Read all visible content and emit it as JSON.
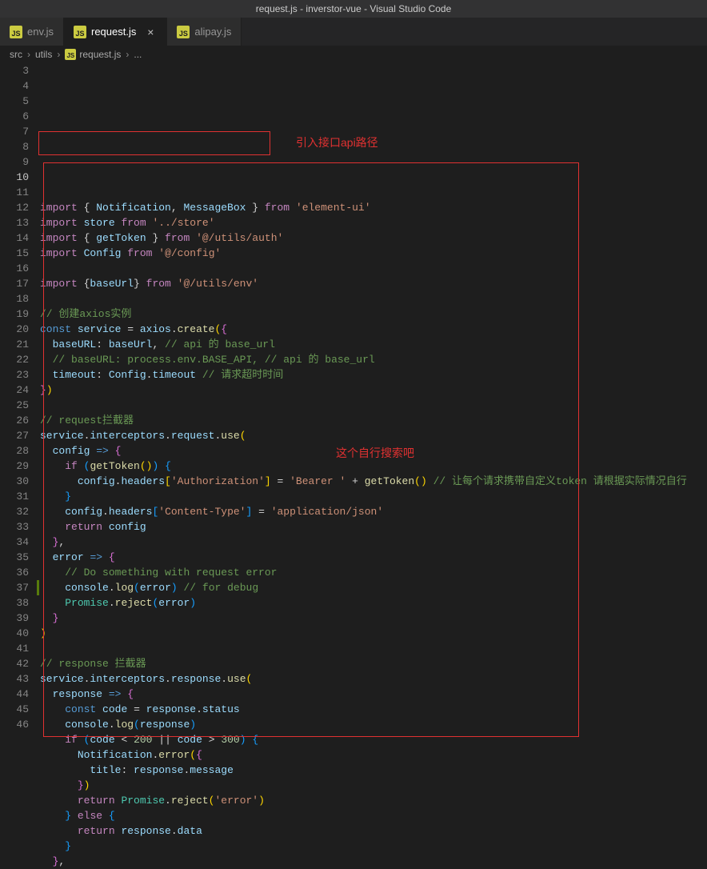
{
  "window_title": "request.js - inverstor-vue - Visual Studio Code",
  "tabs": [
    {
      "icon": "JS",
      "label": "env.js",
      "active": false
    },
    {
      "icon": "JS",
      "label": "request.js",
      "active": true
    },
    {
      "icon": "JS",
      "label": "alipay.js",
      "active": false
    }
  ],
  "breadcrumbs": {
    "parts": [
      "src",
      "utils",
      "request.js",
      "..."
    ],
    "file_icon": "JS"
  },
  "line_start": 3,
  "line_end": 46,
  "current_line": 10,
  "annotations": {
    "box1_label": "引入接口api路径",
    "box2_label": "这个自行搜索吧"
  },
  "code_lines": [
    {
      "n": 3,
      "tokens": [
        [
          "kw2",
          "import"
        ],
        [
          "pun",
          " { "
        ],
        [
          "var",
          "Notification"
        ],
        [
          "pun",
          ", "
        ],
        [
          "var",
          "MessageBox"
        ],
        [
          "pun",
          " } "
        ],
        [
          "kw2",
          "from"
        ],
        [
          "pun",
          " "
        ],
        [
          "str",
          "'element-ui'"
        ]
      ]
    },
    {
      "n": 4,
      "tokens": [
        [
          "kw2",
          "import"
        ],
        [
          "pun",
          " "
        ],
        [
          "var",
          "store"
        ],
        [
          "pun",
          " "
        ],
        [
          "kw2",
          "from"
        ],
        [
          "pun",
          " "
        ],
        [
          "str",
          "'../store'"
        ]
      ]
    },
    {
      "n": 5,
      "tokens": [
        [
          "kw2",
          "import"
        ],
        [
          "pun",
          " { "
        ],
        [
          "var",
          "getToken"
        ],
        [
          "pun",
          " } "
        ],
        [
          "kw2",
          "from"
        ],
        [
          "pun",
          " "
        ],
        [
          "str",
          "'@/utils/auth'"
        ]
      ]
    },
    {
      "n": 6,
      "tokens": [
        [
          "kw2",
          "import"
        ],
        [
          "pun",
          " "
        ],
        [
          "var",
          "Config"
        ],
        [
          "pun",
          " "
        ],
        [
          "kw2",
          "from"
        ],
        [
          "pun",
          " "
        ],
        [
          "str",
          "'@/config'"
        ]
      ]
    },
    {
      "n": 7,
      "tokens": []
    },
    {
      "n": 8,
      "tokens": [
        [
          "kw2",
          "import"
        ],
        [
          "pun",
          " {"
        ],
        [
          "var",
          "baseUrl"
        ],
        [
          "pun",
          "} "
        ],
        [
          "kw2",
          "from"
        ],
        [
          "pun",
          " "
        ],
        [
          "str",
          "'@/utils/env'"
        ]
      ]
    },
    {
      "n": 9,
      "tokens": []
    },
    {
      "n": 10,
      "tokens": [
        [
          "cmt",
          "// 创建axios实例"
        ]
      ]
    },
    {
      "n": 11,
      "tokens": [
        [
          "kw",
          "const"
        ],
        [
          "pun",
          " "
        ],
        [
          "var",
          "service"
        ],
        [
          "pun",
          " = "
        ],
        [
          "var",
          "axios"
        ],
        [
          "pun",
          "."
        ],
        [
          "fn",
          "create"
        ],
        [
          "yel",
          "("
        ],
        [
          "purp",
          "{"
        ]
      ]
    },
    {
      "n": 12,
      "tokens": [
        [
          "pun",
          "  "
        ],
        [
          "var",
          "baseURL"
        ],
        [
          "pun",
          ": "
        ],
        [
          "var",
          "baseUrl"
        ],
        [
          "pun",
          ", "
        ],
        [
          "cmt",
          "// api 的 base_url"
        ]
      ]
    },
    {
      "n": 13,
      "tokens": [
        [
          "pun",
          "  "
        ],
        [
          "cmt",
          "// baseURL: process.env.BASE_API, // api 的 base_url"
        ]
      ]
    },
    {
      "n": 14,
      "tokens": [
        [
          "pun",
          "  "
        ],
        [
          "var",
          "timeout"
        ],
        [
          "pun",
          ": "
        ],
        [
          "var",
          "Config"
        ],
        [
          "pun",
          "."
        ],
        [
          "var",
          "timeout"
        ],
        [
          "pun",
          " "
        ],
        [
          "cmt",
          "// 请求超时时间"
        ]
      ]
    },
    {
      "n": 15,
      "tokens": [
        [
          "purp",
          "}"
        ],
        [
          "yel",
          ")"
        ]
      ]
    },
    {
      "n": 16,
      "tokens": []
    },
    {
      "n": 17,
      "tokens": [
        [
          "cmt",
          "// request拦截器"
        ]
      ]
    },
    {
      "n": 18,
      "tokens": [
        [
          "var",
          "service"
        ],
        [
          "pun",
          "."
        ],
        [
          "var",
          "interceptors"
        ],
        [
          "pun",
          "."
        ],
        [
          "var",
          "request"
        ],
        [
          "pun",
          "."
        ],
        [
          "fn",
          "use"
        ],
        [
          "yel",
          "("
        ]
      ]
    },
    {
      "n": 19,
      "tokens": [
        [
          "pun",
          "  "
        ],
        [
          "var",
          "config"
        ],
        [
          "pun",
          " "
        ],
        [
          "kw",
          "=>"
        ],
        [
          "pun",
          " "
        ],
        [
          "purp",
          "{"
        ]
      ]
    },
    {
      "n": 20,
      "tokens": [
        [
          "pun",
          "    "
        ],
        [
          "kw2",
          "if"
        ],
        [
          "pun",
          " "
        ],
        [
          "blu",
          "("
        ],
        [
          "fn",
          "getToken"
        ],
        [
          "yel",
          "()"
        ],
        [
          "blu",
          ")"
        ],
        [
          "pun",
          " "
        ],
        [
          "blu",
          "{"
        ]
      ]
    },
    {
      "n": 21,
      "tokens": [
        [
          "pun",
          "      "
        ],
        [
          "var",
          "config"
        ],
        [
          "pun",
          "."
        ],
        [
          "var",
          "headers"
        ],
        [
          "yel",
          "["
        ],
        [
          "str",
          "'Authorization'"
        ],
        [
          "yel",
          "]"
        ],
        [
          "pun",
          " = "
        ],
        [
          "str",
          "'Bearer '"
        ],
        [
          "pun",
          " + "
        ],
        [
          "fn",
          "getToken"
        ],
        [
          "yel",
          "()"
        ],
        [
          "pun",
          " "
        ],
        [
          "cmt",
          "// 让每个请求携带自定义token 请根据实际情况自行"
        ]
      ]
    },
    {
      "n": 22,
      "tokens": [
        [
          "pun",
          "    "
        ],
        [
          "blu",
          "}"
        ]
      ]
    },
    {
      "n": 23,
      "tokens": [
        [
          "pun",
          "    "
        ],
        [
          "var",
          "config"
        ],
        [
          "pun",
          "."
        ],
        [
          "var",
          "headers"
        ],
        [
          "blu",
          "["
        ],
        [
          "str",
          "'Content-Type'"
        ],
        [
          "blu",
          "]"
        ],
        [
          "pun",
          " = "
        ],
        [
          "str",
          "'application/json'"
        ]
      ]
    },
    {
      "n": 24,
      "tokens": [
        [
          "pun",
          "    "
        ],
        [
          "kw2",
          "return"
        ],
        [
          "pun",
          " "
        ],
        [
          "var",
          "config"
        ]
      ]
    },
    {
      "n": 25,
      "tokens": [
        [
          "pun",
          "  "
        ],
        [
          "purp",
          "}"
        ],
        [
          "pun",
          ","
        ]
      ]
    },
    {
      "n": 26,
      "tokens": [
        [
          "pun",
          "  "
        ],
        [
          "var",
          "error"
        ],
        [
          "pun",
          " "
        ],
        [
          "kw",
          "=>"
        ],
        [
          "pun",
          " "
        ],
        [
          "purp",
          "{"
        ]
      ]
    },
    {
      "n": 27,
      "tokens": [
        [
          "pun",
          "    "
        ],
        [
          "cmt",
          "// Do something with request error"
        ]
      ]
    },
    {
      "n": 28,
      "tokens": [
        [
          "pun",
          "    "
        ],
        [
          "var",
          "console"
        ],
        [
          "pun",
          "."
        ],
        [
          "fn",
          "log"
        ],
        [
          "blu",
          "("
        ],
        [
          "var",
          "error"
        ],
        [
          "blu",
          ")"
        ],
        [
          "pun",
          " "
        ],
        [
          "cmt",
          "// for debug"
        ]
      ]
    },
    {
      "n": 29,
      "tokens": [
        [
          "pun",
          "    "
        ],
        [
          "cls",
          "Promise"
        ],
        [
          "pun",
          "."
        ],
        [
          "fn",
          "reject"
        ],
        [
          "blu",
          "("
        ],
        [
          "var",
          "error"
        ],
        [
          "blu",
          ")"
        ]
      ]
    },
    {
      "n": 30,
      "tokens": [
        [
          "pun",
          "  "
        ],
        [
          "purp",
          "}"
        ]
      ]
    },
    {
      "n": 31,
      "tokens": [
        [
          "yel",
          ")"
        ]
      ]
    },
    {
      "n": 32,
      "tokens": []
    },
    {
      "n": 33,
      "tokens": [
        [
          "cmt",
          "// response 拦截器"
        ]
      ]
    },
    {
      "n": 34,
      "tokens": [
        [
          "var",
          "service"
        ],
        [
          "pun",
          "."
        ],
        [
          "var",
          "interceptors"
        ],
        [
          "pun",
          "."
        ],
        [
          "var",
          "response"
        ],
        [
          "pun",
          "."
        ],
        [
          "fn",
          "use"
        ],
        [
          "yel",
          "("
        ]
      ]
    },
    {
      "n": 35,
      "tokens": [
        [
          "pun",
          "  "
        ],
        [
          "var",
          "response"
        ],
        [
          "pun",
          " "
        ],
        [
          "kw",
          "=>"
        ],
        [
          "pun",
          " "
        ],
        [
          "purp",
          "{"
        ]
      ]
    },
    {
      "n": 36,
      "tokens": [
        [
          "pun",
          "    "
        ],
        [
          "kw",
          "const"
        ],
        [
          "pun",
          " "
        ],
        [
          "var",
          "code"
        ],
        [
          "pun",
          " = "
        ],
        [
          "var",
          "response"
        ],
        [
          "pun",
          "."
        ],
        [
          "var",
          "status"
        ]
      ]
    },
    {
      "n": 37,
      "tokens": [
        [
          "pun",
          "    "
        ],
        [
          "var",
          "console"
        ],
        [
          "pun",
          "."
        ],
        [
          "fn",
          "log"
        ],
        [
          "blu",
          "("
        ],
        [
          "var",
          "response"
        ],
        [
          "blu",
          ")"
        ]
      ]
    },
    {
      "n": 38,
      "tokens": [
        [
          "pun",
          "    "
        ],
        [
          "kw2",
          "if"
        ],
        [
          "pun",
          " "
        ],
        [
          "blu",
          "("
        ],
        [
          "var",
          "code"
        ],
        [
          "pun",
          " < "
        ],
        [
          "num",
          "200"
        ],
        [
          "pun",
          " || "
        ],
        [
          "var",
          "code"
        ],
        [
          "pun",
          " > "
        ],
        [
          "num",
          "300"
        ],
        [
          "blu",
          ")"
        ],
        [
          "pun",
          " "
        ],
        [
          "blu",
          "{"
        ]
      ]
    },
    {
      "n": 39,
      "tokens": [
        [
          "pun",
          "      "
        ],
        [
          "var",
          "Notification"
        ],
        [
          "pun",
          "."
        ],
        [
          "fn",
          "error"
        ],
        [
          "yel",
          "("
        ],
        [
          "purp",
          "{"
        ]
      ]
    },
    {
      "n": 40,
      "tokens": [
        [
          "pun",
          "        "
        ],
        [
          "var",
          "title"
        ],
        [
          "pun",
          ": "
        ],
        [
          "var",
          "response"
        ],
        [
          "pun",
          "."
        ],
        [
          "var",
          "message"
        ]
      ]
    },
    {
      "n": 41,
      "tokens": [
        [
          "pun",
          "      "
        ],
        [
          "purp",
          "}"
        ],
        [
          "yel",
          ")"
        ]
      ]
    },
    {
      "n": 42,
      "tokens": [
        [
          "pun",
          "      "
        ],
        [
          "kw2",
          "return"
        ],
        [
          "pun",
          " "
        ],
        [
          "cls",
          "Promise"
        ],
        [
          "pun",
          "."
        ],
        [
          "fn",
          "reject"
        ],
        [
          "yel",
          "("
        ],
        [
          "str",
          "'error'"
        ],
        [
          "yel",
          ")"
        ]
      ]
    },
    {
      "n": 43,
      "tokens": [
        [
          "pun",
          "    "
        ],
        [
          "blu",
          "}"
        ],
        [
          "pun",
          " "
        ],
        [
          "kw2",
          "else"
        ],
        [
          "pun",
          " "
        ],
        [
          "blu",
          "{"
        ]
      ]
    },
    {
      "n": 44,
      "tokens": [
        [
          "pun",
          "      "
        ],
        [
          "kw2",
          "return"
        ],
        [
          "pun",
          " "
        ],
        [
          "var",
          "response"
        ],
        [
          "pun",
          "."
        ],
        [
          "var",
          "data"
        ]
      ]
    },
    {
      "n": 45,
      "tokens": [
        [
          "pun",
          "    "
        ],
        [
          "blu",
          "}"
        ]
      ]
    },
    {
      "n": 46,
      "tokens": [
        [
          "pun",
          "  "
        ],
        [
          "purp",
          "}"
        ],
        [
          "pun",
          ","
        ]
      ]
    }
  ]
}
